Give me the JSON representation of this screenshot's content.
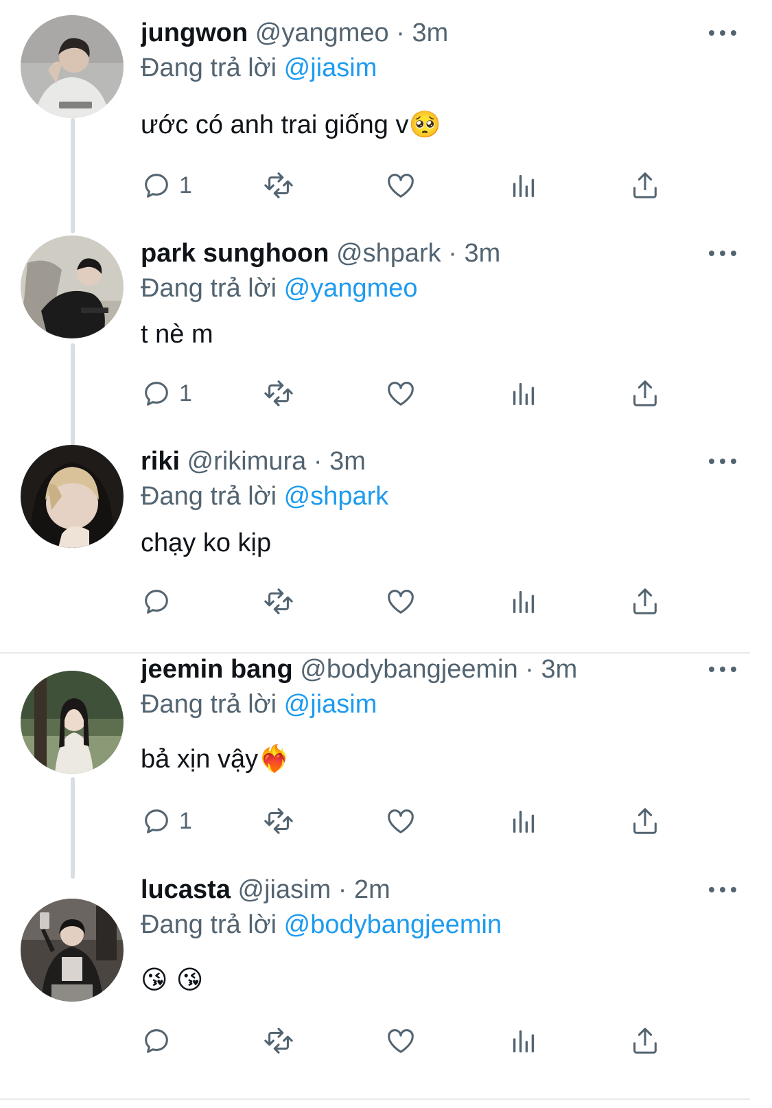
{
  "reply_prefix": "Đang trả lời",
  "dot": "·",
  "tweets": [
    {
      "name": "jungwon",
      "handle": "@yangmeo",
      "time": "3m",
      "reply_to": "@jiasim",
      "text": "ước có anh trai giống v",
      "emoji": "🥺",
      "reply_count": "1",
      "avatar": "person-hoodie-avatar"
    },
    {
      "name": "park sunghoon",
      "handle": "@shpark",
      "time": "3m",
      "reply_to": "@yangmeo",
      "text": "t nè m",
      "emoji": "",
      "reply_count": "1",
      "avatar": "person-leather-jacket-avatar"
    },
    {
      "name": "riki",
      "handle": "@rikimura",
      "time": "3m",
      "reply_to": "@shpark",
      "text": "chạy ko kịp",
      "emoji": "",
      "reply_count": "",
      "avatar": "person-hood-avatar"
    },
    {
      "name": "jeemin bang",
      "handle": "@bodybangjeemin",
      "time": "3m",
      "reply_to": "@jiasim",
      "text": "bả xịn vậy",
      "emoji": "❤️‍🔥",
      "reply_count": "1",
      "avatar": "person-park-avatar"
    },
    {
      "name": "lucasta",
      "handle": "@jiasim",
      "time": "2m",
      "reply_to": "@bodybangjeemin",
      "text": "",
      "emoji": "😘 😘",
      "reply_count": "",
      "avatar": "person-mirror-selfie-avatar"
    }
  ],
  "colors": {
    "text": "#0f1419",
    "secondary": "#536471",
    "mention": "#1d9bf0",
    "thread_line": "#d9dee3"
  }
}
